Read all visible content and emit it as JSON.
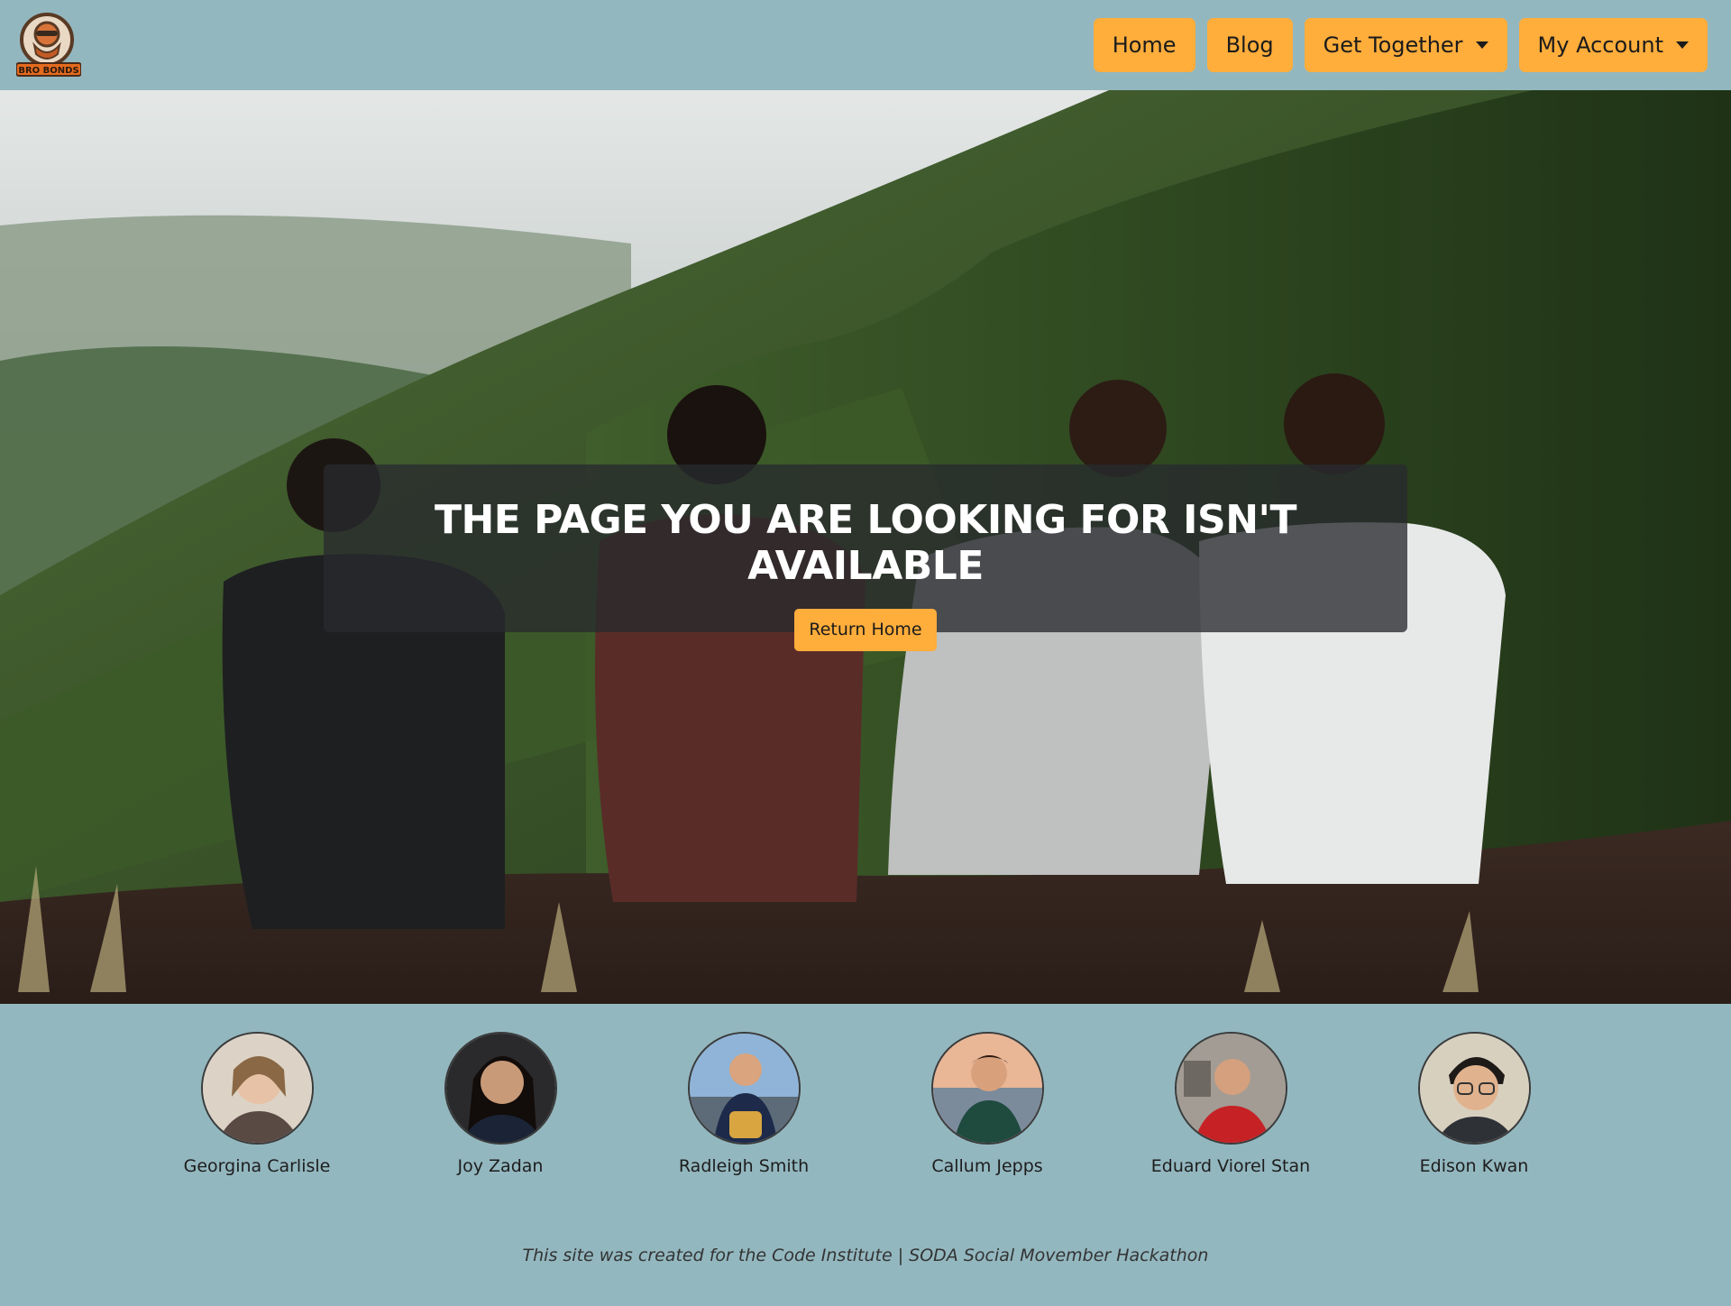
{
  "brand": {
    "logo_text": "BRO BONDS"
  },
  "nav": {
    "home": "Home",
    "blog": "Blog",
    "get_together": "Get Together",
    "my_account": "My Account"
  },
  "hero": {
    "title": "THE PAGE YOU ARE LOOKING FOR ISN'T AVAILABLE",
    "return_button": "Return Home"
  },
  "team": [
    {
      "name": "Georgina Carlisle"
    },
    {
      "name": "Joy Zadan"
    },
    {
      "name": "Radleigh Smith"
    },
    {
      "name": "Callum Jepps"
    },
    {
      "name": "Eduard Viorel Stan"
    },
    {
      "name": "Edison Kwan"
    }
  ],
  "footer": {
    "text": "This site was created for the Code Institute | SODA Social Movember Hackathon"
  },
  "colors": {
    "accent": "#ffad3b",
    "background": "#93b7bf",
    "overlay": "#282a2e"
  }
}
